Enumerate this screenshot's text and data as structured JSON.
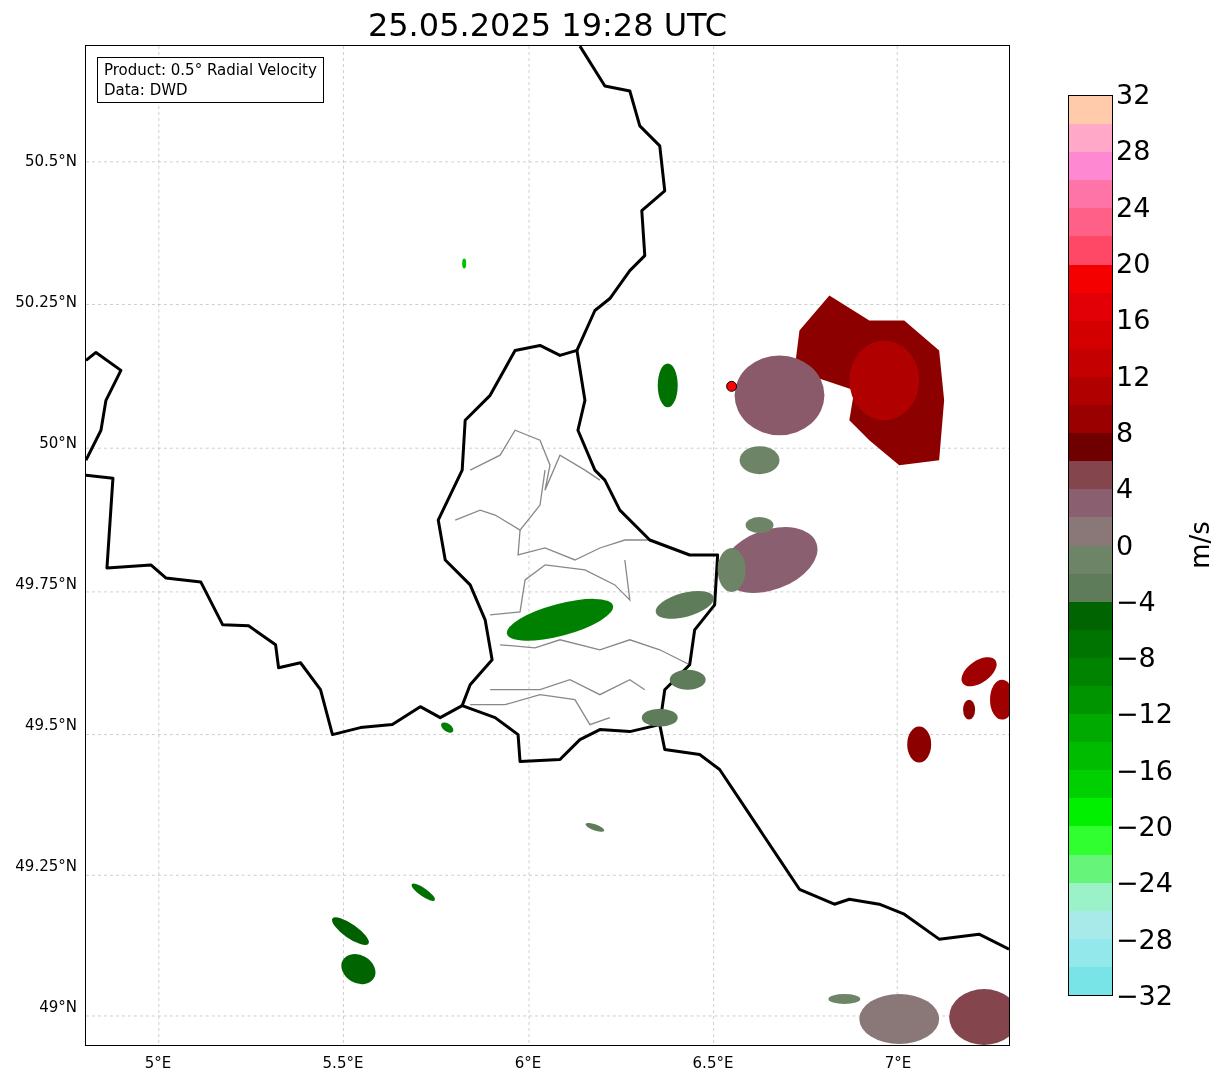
{
  "title": "25.05.2025 19:28 UTC",
  "info_box": {
    "lines": [
      "Product: 0.5° Radial Velocity",
      "Data: DWD"
    ]
  },
  "map": {
    "lat_labels": [
      "50.5°N",
      "50.25°N",
      "50°N",
      "49.75°N",
      "49.5°N",
      "49.25°N",
      "49°N"
    ],
    "lon_labels": [
      "5°E",
      "5.5°E",
      "6°E",
      "6.5°E",
      "7°E"
    ]
  },
  "colorbar": {
    "label": "m/s",
    "ticks": [
      "32",
      "28",
      "24",
      "20",
      "16",
      "12",
      "8",
      "4",
      "0",
      "−4",
      "−8",
      "−12",
      "−16",
      "−20",
      "−24",
      "−28",
      "−32"
    ],
    "bands": [
      {
        "color": "#ffcbaa"
      },
      {
        "color": "#ffa8c8"
      },
      {
        "color": "#ff88d2"
      },
      {
        "color": "#ff74a6"
      },
      {
        "color": "#ff6088"
      },
      {
        "color": "#ff4866"
      },
      {
        "color": "#f50000"
      },
      {
        "color": "#e20006"
      },
      {
        "color": "#d40000"
      },
      {
        "color": "#c40000"
      },
      {
        "color": "#b00000"
      },
      {
        "color": "#9a0000"
      },
      {
        "color": "#700000"
      },
      {
        "color": "#84464c"
      },
      {
        "color": "#8a6070"
      },
      {
        "color": "#8a7878"
      },
      {
        "color": "#6e8466"
      },
      {
        "color": "#5e7c5a"
      },
      {
        "color": "#006400"
      },
      {
        "color": "#007400"
      },
      {
        "color": "#008400"
      },
      {
        "color": "#009400"
      },
      {
        "color": "#00aa00"
      },
      {
        "color": "#00bc00"
      },
      {
        "color": "#00d000"
      },
      {
        "color": "#00f000"
      },
      {
        "color": "#30ff30"
      },
      {
        "color": "#66f57a"
      },
      {
        "color": "#9cf2c8"
      },
      {
        "color": "#a8eaea"
      },
      {
        "color": "#92e8ea"
      },
      {
        "color": "#78e4e8"
      }
    ]
  }
}
